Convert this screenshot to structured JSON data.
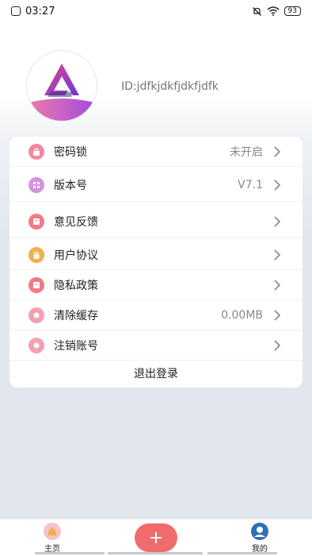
{
  "status_bar": {
    "time": "03:27",
    "battery": "93"
  },
  "profile": {
    "user_id": "ID:jdfkjdkfjdkfjdfk"
  },
  "settings": {
    "items": [
      {
        "label": "密码锁",
        "value": "未开启",
        "icon": "lock-icon",
        "color": "#f08aa0"
      },
      {
        "label": "版本号",
        "value": "V7.1",
        "icon": "version-icon",
        "color": "#d692e0"
      },
      {
        "label": "意见反馈",
        "value": "",
        "icon": "feedback-icon",
        "color": "#f07a86"
      },
      {
        "label": "用户协议",
        "value": "",
        "icon": "agreement-icon",
        "color": "#f0b14a"
      },
      {
        "label": "隐私政策",
        "value": "",
        "icon": "privacy-icon",
        "color": "#f07a86"
      },
      {
        "label": "清除缓存",
        "value": "0.00MB",
        "icon": "clear-cache-icon",
        "color": "#f4a0b4"
      },
      {
        "label": "注销账号",
        "value": "",
        "icon": "delete-account-icon",
        "color": "#f4a0b4"
      }
    ],
    "logout_label": "退出登录"
  },
  "bottom_nav": {
    "home_label": "主页",
    "mine_label": "我的",
    "add_symbol": "+"
  },
  "colors": {
    "accent": "#f06b6b",
    "logo_purple": "#9b3fd6"
  }
}
